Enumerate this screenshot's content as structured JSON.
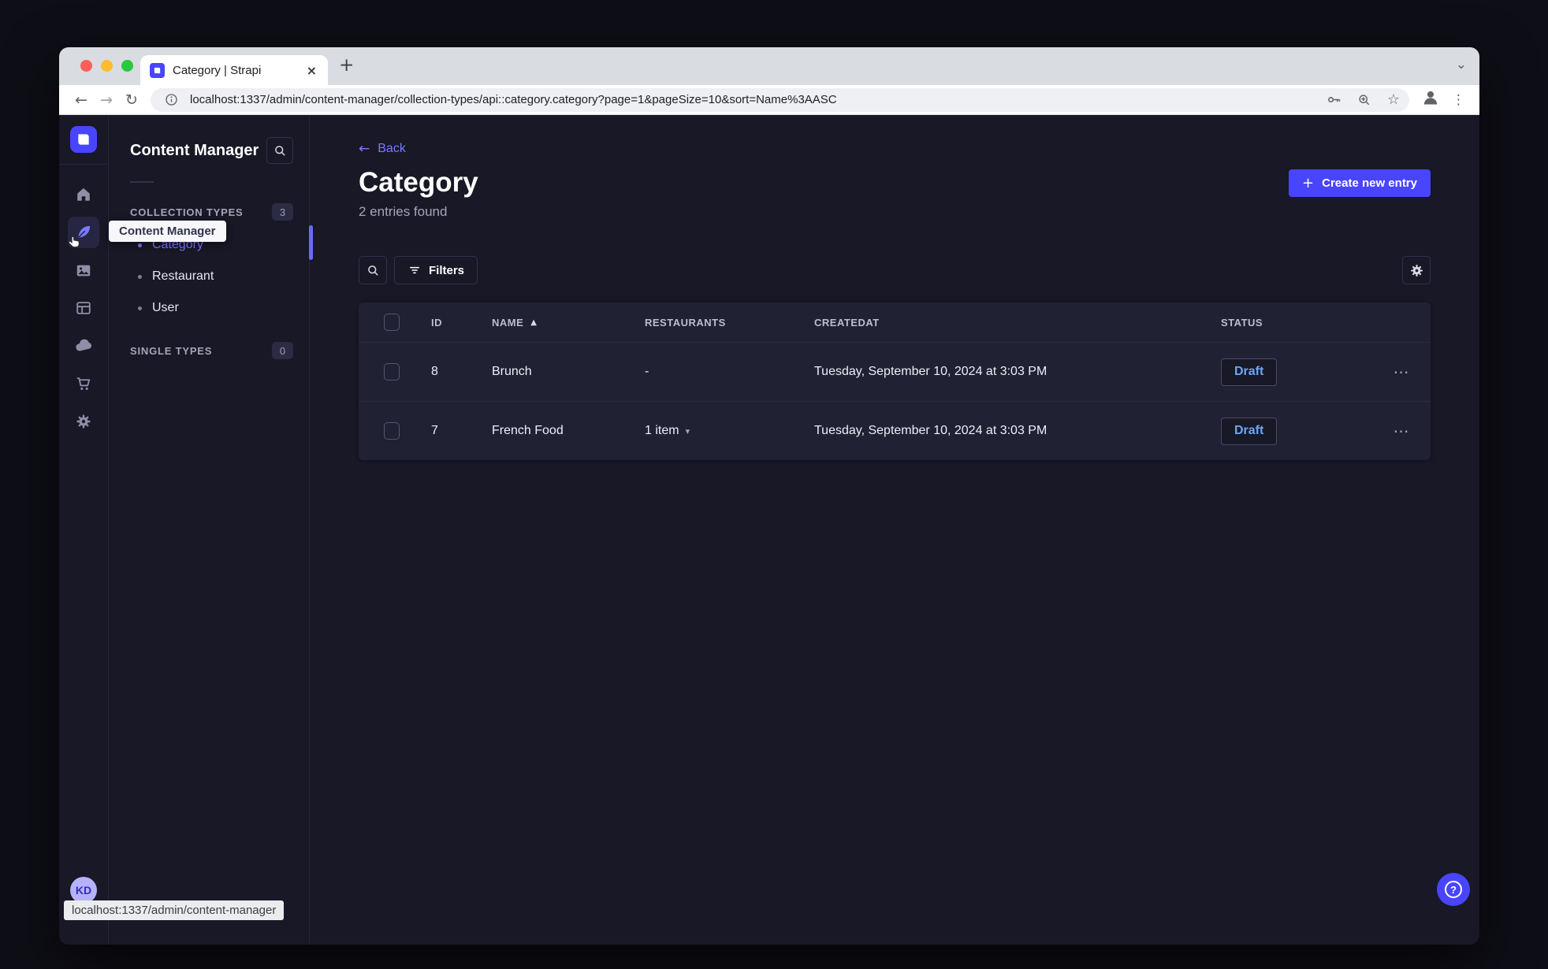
{
  "browser": {
    "tab_title": "Category | Strapi",
    "url": "localhost:1337/admin/content-manager/collection-types/api::category.category?page=1&pageSize=10&sort=Name%3AASC",
    "status_bar_link": "localhost:1337/admin/content-manager"
  },
  "icons": {
    "back_arrow": "←",
    "forward_arrow": "→",
    "reload": "↻",
    "menu_dots_vertical": "⋮",
    "more_dots_horizontal": "⋯",
    "tab_close": "×",
    "new_tab": "+",
    "strip_chevron": "⌄",
    "star": "☆",
    "sort_asc": "▲",
    "caret_down": "▾",
    "plus": "+",
    "question": "?"
  },
  "rail": {
    "tooltip": "Content Manager",
    "avatar_initials": "KD"
  },
  "subnav": {
    "title": "Content Manager",
    "collection_section": {
      "label": "COLLECTION TYPES",
      "badge": "3"
    },
    "items": [
      {
        "label": "Category",
        "active": true
      },
      {
        "label": "Restaurant",
        "active": false
      },
      {
        "label": "User",
        "active": false
      }
    ],
    "single_section": {
      "label": "SINGLE TYPES",
      "badge": "0"
    }
  },
  "main": {
    "back": "Back",
    "title": "Category",
    "subtitle": "2 entries found",
    "create_button": "Create new entry",
    "filters": "Filters"
  },
  "table": {
    "headers": {
      "id": "ID",
      "name": "NAME",
      "restaurants": "RESTAURANTS",
      "createdat": "CREATEDAT",
      "status": "STATUS"
    },
    "rows": [
      {
        "id": "8",
        "name": "Brunch",
        "restaurants": "-",
        "createdat": "Tuesday, September 10, 2024 at 3:03 PM",
        "status": "Draft"
      },
      {
        "id": "7",
        "name": "French Food",
        "restaurants": "1 item",
        "createdat": "Tuesday, September 10, 2024 at 3:03 PM",
        "status": "Draft"
      }
    ]
  },
  "colors": {
    "primary": "#4945ff",
    "link": "#7b79ff",
    "draft_text": "#6ba6f3",
    "app_background": "#181826",
    "card_background": "#212134",
    "border": "#32324d"
  }
}
